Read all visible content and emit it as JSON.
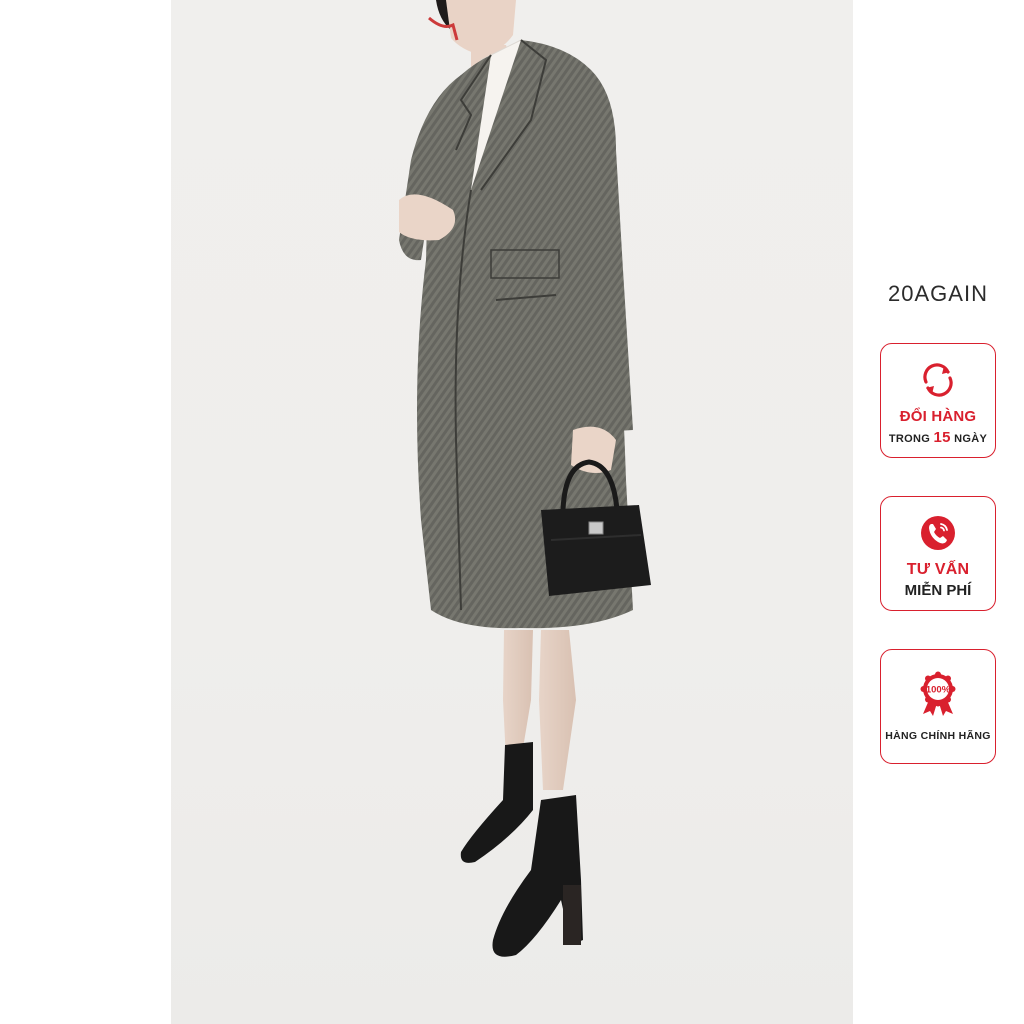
{
  "brand": {
    "name": "20AGAIN"
  },
  "badges": [
    {
      "icon": "exchange-arrows-icon",
      "line1": "ĐỔI HÀNG",
      "line2_pre": "TRONG",
      "line2_num": "15",
      "line2_post": "NGÀY"
    },
    {
      "icon": "phone-call-icon",
      "line1": "TƯ VẤN",
      "line2": "MIỄN PHÍ"
    },
    {
      "icon": "genuine-seal-icon",
      "seal_text": "100%",
      "line1": "HÀNG CHÍNH HÃNG"
    }
  ],
  "colors": {
    "accent": "#d9202e",
    "background": "#ffffff",
    "photo_bg": "#efeeec"
  }
}
